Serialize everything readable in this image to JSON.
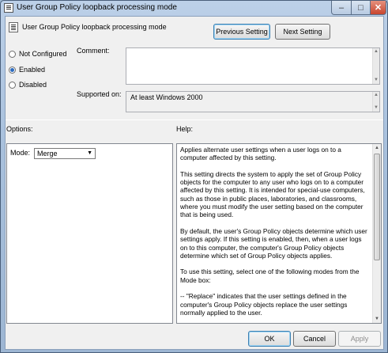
{
  "window": {
    "title": "User Group Policy loopback processing mode",
    "controls": {
      "minimize": "–",
      "maximize": "□",
      "close": "✕"
    }
  },
  "header": {
    "setting_name": "User Group Policy loopback processing mode",
    "prev_button": "Previous Setting",
    "next_button": "Next Setting"
  },
  "state": {
    "options": [
      {
        "label": "Not Configured",
        "checked": false
      },
      {
        "label": "Enabled",
        "checked": true
      },
      {
        "label": "Disabled",
        "checked": false
      }
    ]
  },
  "comment": {
    "label": "Comment:",
    "value": ""
  },
  "supported": {
    "label": "Supported on:",
    "value": "At least Windows 2000"
  },
  "options_section": {
    "label": "Options:",
    "mode_label": "Mode:",
    "mode_value": "Merge"
  },
  "help_section": {
    "label": "Help:",
    "paragraphs": [
      "Applies alternate user settings when a user logs on to a computer affected by this setting.",
      "This setting directs the system to apply the set of Group Policy objects for the computer to any user who logs on to a computer affected by this setting. It is intended for special-use computers, such as those in public places, laboratories, and classrooms, where you must modify the user setting based on the computer that is being used.",
      "By default, the user's Group Policy objects determine which user settings apply. If this setting is enabled, then, when a user logs on to this computer, the computer's Group Policy objects determine which set of Group Policy objects applies.",
      "To use this setting, select one of the following modes from the Mode box:",
      "--  \"Replace\" indicates that the user settings defined in the computer's Group Policy objects replace the user settings normally applied to the user."
    ]
  },
  "footer": {
    "ok": "OK",
    "cancel": "Cancel",
    "apply": "Apply"
  }
}
